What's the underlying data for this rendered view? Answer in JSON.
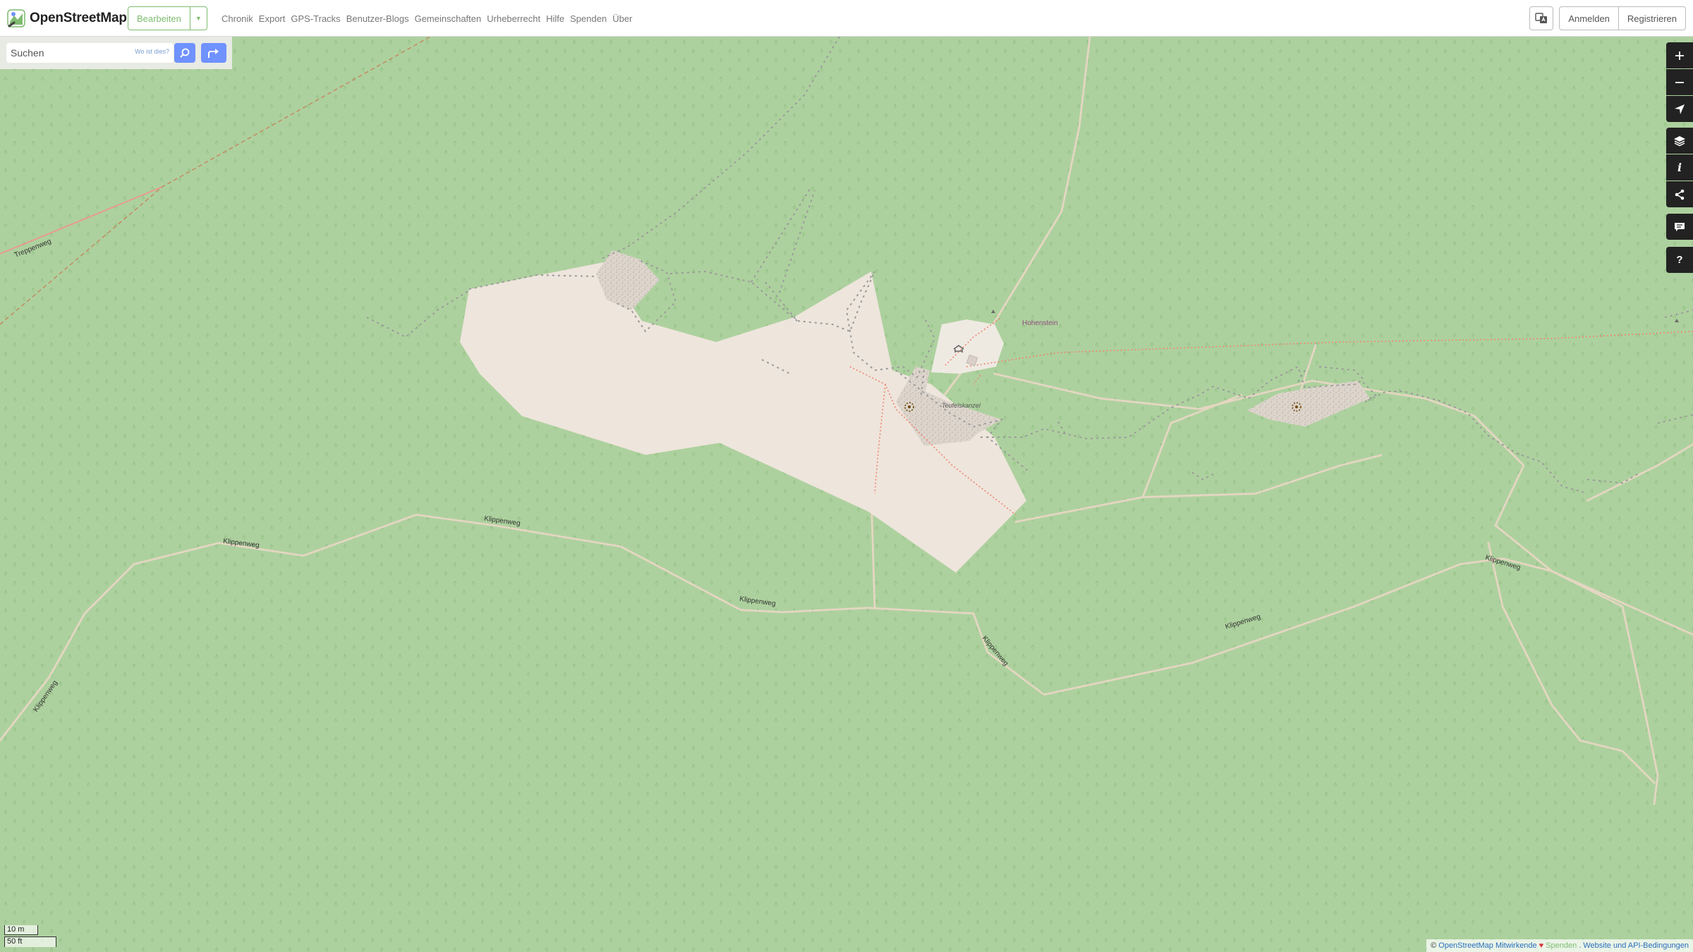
{
  "header": {
    "brand": "OpenStreetMap",
    "edit_label": "Bearbeiten",
    "nav": [
      "Chronik",
      "Export",
      "GPS-Tracks",
      "Benutzer-Blogs",
      "Gemeinschaften",
      "Urheberrecht",
      "Hilfe",
      "Spenden",
      "Über"
    ],
    "login": "Anmelden",
    "signup": "Registrieren"
  },
  "search": {
    "placeholder": "Suchen",
    "where_is_this": "Wo ist dies?"
  },
  "map": {
    "labels": {
      "treppenweg": "Treppenweg",
      "hohenstein": "Hohenstein",
      "teufelskanzel": "Teufelskanzel",
      "klippenweg_1": "Klippenweg",
      "klippenweg_2": "Klippenweg",
      "klippenweg_3": "Klippenweg",
      "klippenweg_4": "Klippenweg",
      "klippenweg_5": "Klippenweg",
      "klippenweg_6": "Klippenweg",
      "klippenweg_7": "Klippenweg"
    },
    "colors": {
      "forest": "#add19e",
      "rock": "#eee5dc",
      "scree": "#e5ddd5",
      "path": "#e8d7c4",
      "trail": "#fa8072",
      "cliff": "#999999"
    }
  },
  "controls": [
    "zoom-in-icon",
    "zoom-out-icon",
    "locate-icon",
    "layers-icon",
    "info-icon",
    "share-icon",
    "note-icon",
    "help-icon"
  ],
  "scale": {
    "metric": "10 m",
    "imperial": "50 ft"
  },
  "attribution": {
    "copyright": "©",
    "contributors": "OpenStreetMap Mitwirkende",
    "heart": "♥",
    "donate": "Spenden",
    "terms": ". Website und API-Bedingungen"
  }
}
